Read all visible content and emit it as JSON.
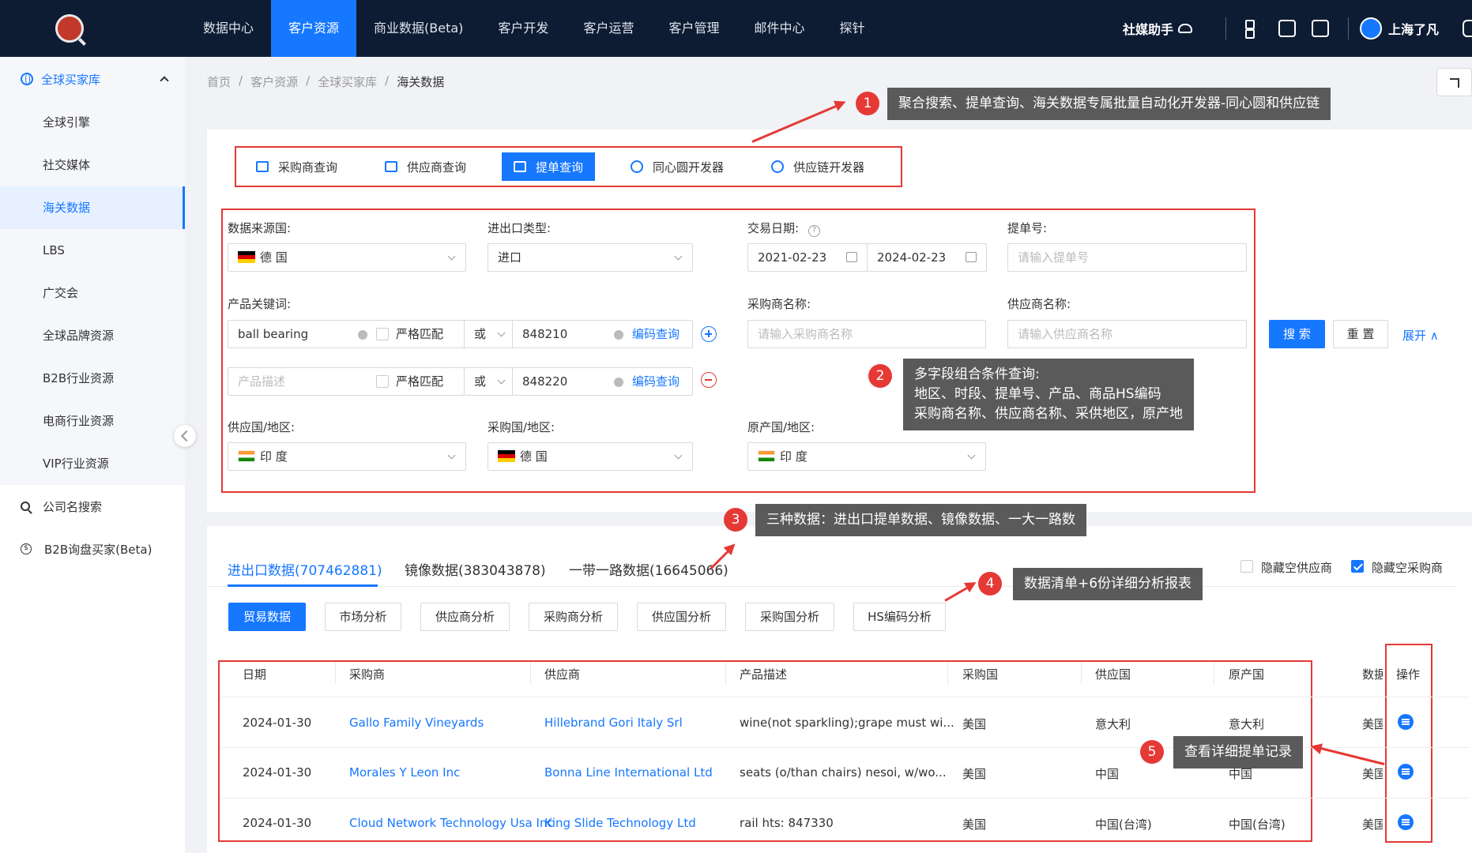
{
  "nav": {
    "items": [
      "数据中心",
      "客户资源",
      "商业数据(Beta)",
      "客户开发",
      "客户运营",
      "客户管理",
      "邮件中心",
      "探针"
    ],
    "active_index": 1
  },
  "top_right": {
    "social": "社媒助手",
    "user": "上海了凡"
  },
  "sidebar": {
    "group": "全球买家库",
    "items": [
      "全球引擎",
      "社交媒体",
      "海关数据",
      "LBS",
      "广交会",
      "全球品牌资源",
      "B2B行业资源",
      "电商行业资源",
      "VIP行业资源"
    ],
    "active_index": 2,
    "extra": [
      "公司名搜索",
      "B2B询盘买家(Beta)"
    ]
  },
  "breadcrumb": [
    "首页",
    "客户资源",
    "全球买家库",
    "海关数据"
  ],
  "query_tabs": [
    "采购商查询",
    "供应商查询",
    "提单查询",
    "同心圆开发器",
    "供应链开发器"
  ],
  "query_active_index": 2,
  "form": {
    "source_country_label": "数据来源国:",
    "source_country": "德 国",
    "io_type_label": "进出口类型:",
    "io_type": "进口",
    "date_label": "交易日期:",
    "date_from": "2021-02-23",
    "date_to": "2024-02-23",
    "bill_no_label": "提单号:",
    "bill_no_ph": "请输入提单号",
    "keyword_label": "产品关键词:",
    "kw1": "ball bearing",
    "strict": "严格匹配",
    "or": "或",
    "hs1": "848210",
    "code_query": "编码查询",
    "kw2_ph": "产品描述",
    "hs2": "848220",
    "buyer_name_label": "采购商名称:",
    "buyer_name_ph": "请输入采购商名称",
    "supplier_name_label": "供应商名称:",
    "supplier_name_ph": "请输入供应商名称",
    "supply_country_label": "供应国/地区:",
    "supply_country": "印 度",
    "buy_country_label": "采购国/地区:",
    "buy_country": "德 国",
    "origin_label": "原产国/地区:",
    "origin": "印 度",
    "search": "搜 索",
    "reset": "重 置",
    "expand": "展开"
  },
  "callouts": [
    "聚合搜索、提单查询、海关数据专属批量自动化开发器-同心圆和供应链",
    "多字段组合条件查询:\n地区、时段、提单号、产品、商品HS编码\n采购商名称、供应商名称、采供地区，原产地",
    "三种数据：进出口提单数据、镜像数据、一大一路数",
    "数据清单+6份详细分析报表",
    "查看详细提单记录"
  ],
  "data_tabs": [
    "进出口数据(707462881)",
    "镜像数据(383043878)",
    "一带一路数据(16645066)"
  ],
  "hide_opts": [
    {
      "label": "隐藏空供应商",
      "checked": false
    },
    {
      "label": "隐藏空采购商",
      "checked": true
    }
  ],
  "analysis_tabs": [
    "贸易数据",
    "市场分析",
    "供应商分析",
    "采购商分析",
    "供应国分析",
    "采购国分析",
    "HS编码分析"
  ],
  "table": {
    "headers": [
      "日期",
      "采购商",
      "供应商",
      "产品描述",
      "采购国",
      "供应国",
      "原产国",
      "数据",
      "操作"
    ],
    "rows": [
      [
        "2024-01-30",
        "Gallo Family Vineyards",
        "Hillebrand Gori Italy Srl",
        "wine(not sparkling);grape must wi...",
        "美国",
        "意大利",
        "意大利",
        "美国"
      ],
      [
        "2024-01-30",
        "Morales Y Leon Inc",
        "Bonna Line International Ltd",
        "seats (o/than chairs) nesoi, w/wo...",
        "美国",
        "中国",
        "中国",
        "美国"
      ],
      [
        "2024-01-30",
        "Cloud Network Technology Usa Inc",
        "King Slide Technology Ltd",
        "rail hts: 847330",
        "美国",
        "中国(台湾)",
        "中国(台湾)",
        "美国"
      ]
    ]
  },
  "colors": {
    "nav_bg": "#0e1c33",
    "accent": "#1677ff",
    "highlight": "#e53935",
    "callout_bg": "#5a5a5a"
  }
}
